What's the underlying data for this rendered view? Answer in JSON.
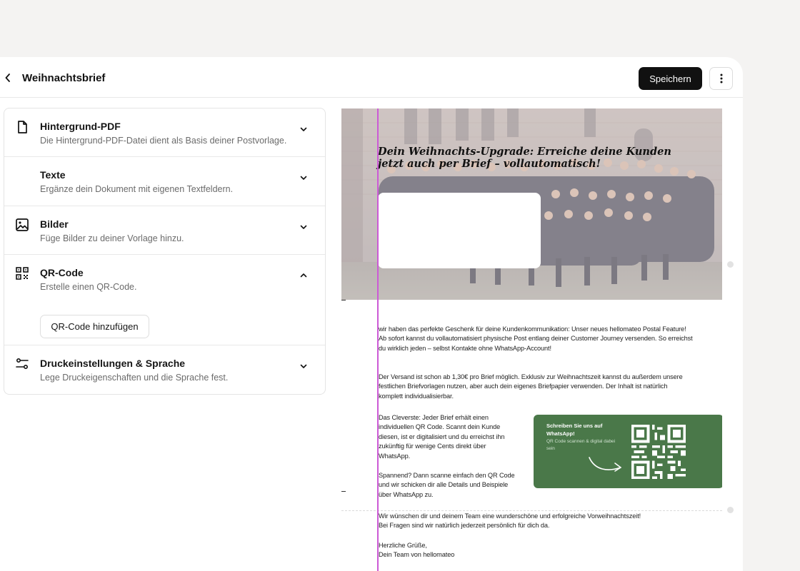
{
  "header": {
    "title": "Weihnachtsbrief",
    "save_label": "Speichern"
  },
  "icons": {
    "back": "chevron-left-icon",
    "more": "more-vertical-icon",
    "file": "file-icon",
    "image": "image-icon",
    "qr": "qr-code-icon",
    "settings": "sliders-icon"
  },
  "sections": [
    {
      "title": "Hintergrund-PDF",
      "desc": "Die Hintergrund-PDF-Datei dient als Basis deiner Postvorlage.",
      "expanded": false
    },
    {
      "title": "Texte",
      "desc": "Ergänze dein Dokument mit eigenen Textfeldern.",
      "expanded": false
    },
    {
      "title": "Bilder",
      "desc": "Füge Bilder zu deiner Vorlage hinzu.",
      "expanded": false
    },
    {
      "title": "QR-Code",
      "desc": "Erstelle einen QR-Code.",
      "expanded": true,
      "button": "QR-Code hinzufügen"
    },
    {
      "title": "Druckeinstellungen & Sprache",
      "desc": "Lege Druckeigenschaften und die Sprache fest.",
      "expanded": false
    }
  ],
  "letter": {
    "headline": "Dein Weihnachts-Upgrade: Erreiche deine Kunden jetzt auch per Brief – vollautomatisch!",
    "p1": "wir haben das perfekte Geschenk für deine Kundenkommunikation: Unser neues hellomateo Postal Feature!\nAb sofort kannst du vollautomatisiert physische Post entlang deiner Customer Journey versenden. So erreichst du wirklich jeden – selbst Kontakte ohne WhatsApp-Account!",
    "p2": "Der Versand ist schon ab 1,30€ pro Brief möglich. Exklusiv zur Weihnachtszeit kannst du außerdem unsere festlichen Briefvorlagen nutzen, aber auch dein eigenes Briefpapier verwenden. Der Inhalt ist natürlich komplett individualisierbar.",
    "p3": "Das Cleverste: Jeder Brief erhält einen individuellen QR Code. Scannt dein Kunde diesen, ist er digitalisiert und du erreichst ihn zukünftig für wenige Cents direkt über WhatsApp.",
    "p4": "Spannend? Dann scanne einfach den QR Code und wir schicken dir alle Details und Beispiele über WhatsApp zu.",
    "p5": "Wir wünschen dir und deinem Team eine wunderschöne und erfolgreiche Vorweihnachtszeit!\nBei Fragen sind wir natürlich jederzeit persönlich für dich da.",
    "p6": "Herzliche Grüße,\nDein Team von hellomateo",
    "qr_card_title": "Schreiben Sie uns auf WhatsApp!",
    "qr_card_sub": "QR Code scannen & digital dabei sein",
    "qr_card_color": "#4a7849"
  },
  "colors": {
    "guide": "#cc5ad6",
    "primary_button": "#111111"
  }
}
